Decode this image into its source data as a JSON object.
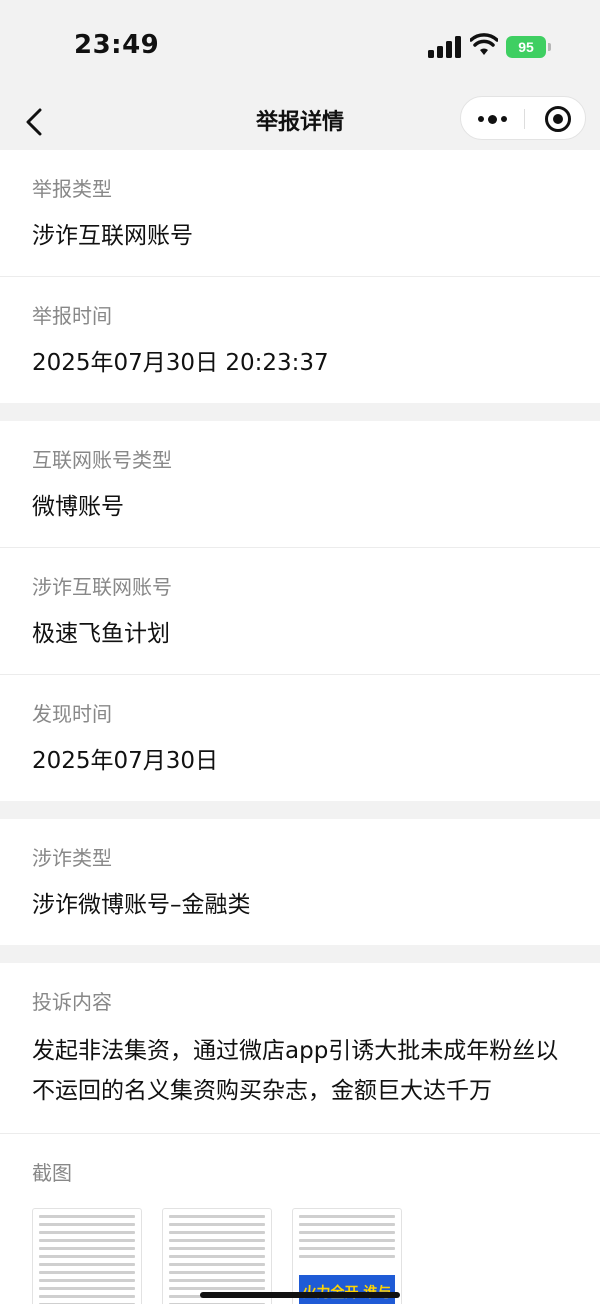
{
  "status": {
    "time": "23:49",
    "battery": "95"
  },
  "nav": {
    "title": "举报详情"
  },
  "section1": [
    {
      "label": "举报类型",
      "value": "涉诈互联网账号"
    },
    {
      "label": "举报时间",
      "value": "2025年07月30日 20:23:37"
    }
  ],
  "section2": [
    {
      "label": "互联网账号类型",
      "value": "微博账号"
    },
    {
      "label": "涉诈互联网账号",
      "value": "极速飞鱼计划"
    },
    {
      "label": "发现时间",
      "value": "2025年07月30日"
    }
  ],
  "section3": [
    {
      "label": "涉诈类型",
      "value": "涉诈微博账号–金融类"
    }
  ],
  "section4": {
    "complaint_label": "投诉内容",
    "complaint_value": "发起非法集资，通过微店app引诱大批未成年粉丝以不运回的名义集资购买杂志，金额巨大达千万",
    "screenshot_label": "截图",
    "screenshot_banner": "火力全开 谁与争锋"
  }
}
